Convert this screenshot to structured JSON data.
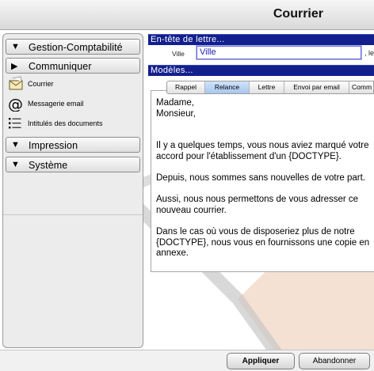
{
  "window": {
    "title": "Courrier"
  },
  "sidebar": {
    "sections": [
      {
        "label": "Gestion-Comptabilité",
        "expanded": true
      },
      {
        "label": "Communiquer",
        "expanded": false
      },
      {
        "label": "Impression",
        "expanded": true
      },
      {
        "label": "Système",
        "expanded": true
      }
    ],
    "items": [
      {
        "label": "Courrier",
        "icon": "envelope-icon"
      },
      {
        "label": "Messagerie email",
        "icon": "at-sign-icon"
      },
      {
        "label": "Intitulés des documents",
        "icon": "list-icon"
      }
    ]
  },
  "header_group": {
    "title": "En-tête de lettre...",
    "ville_label": "Ville",
    "ville_value": "Ville",
    "trailing_label": ", le"
  },
  "models_group": {
    "title": "Modèles...",
    "tabs": [
      "Rappel",
      "Relance",
      "Lettre",
      "Envoi par email",
      "Comm"
    ],
    "active_tab": "Relance"
  },
  "letter": {
    "text": "Madame,\nMonsieur,\n\n\nIl y a quelques temps, vous nous aviez marqué votre\naccord pour l'établissement d'un {DOCTYPE}.\n\nDepuis, nous sommes sans nouvelles de votre part.\n\nAussi, nous nous permettons de vous adresser ce\nnouveau courrier.\n\nDans le cas où vous de disposeriez plus de notre\n{DOCTYPE}, nous vous en fournissons une copie en\nannexe."
  },
  "footer": {
    "apply_label": "Appliquer",
    "cancel_label": "Abandonner"
  },
  "colors": {
    "group_header": "#131f8c",
    "active_tab": "#b9d4f5",
    "input_text": "#1d1db5"
  }
}
